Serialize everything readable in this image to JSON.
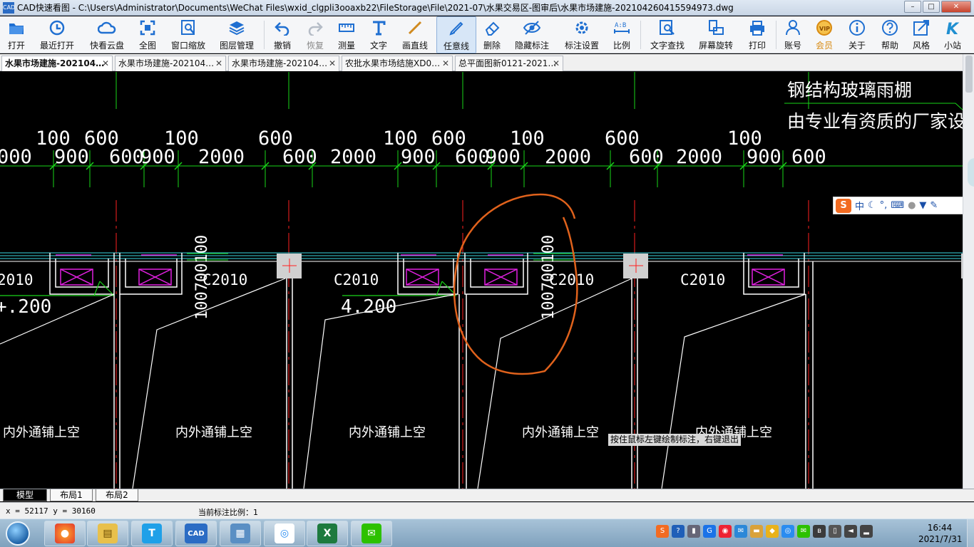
{
  "window": {
    "app_icon": "CAD",
    "title": "CAD快速看图 - C:\\Users\\Administrator\\Documents\\WeChat Files\\wxid_clgpli3ooaxb22\\FileStorage\\File\\2021-07\\水果交易区-图审后\\水果市场建施-202104260415594973.dwg",
    "buttons": {
      "minimize": "–",
      "maximize": "□",
      "close": "✕"
    }
  },
  "toolbar": {
    "items": [
      {
        "label": "打开",
        "icon": "folder-open-icon"
      },
      {
        "label": "最近打开",
        "icon": "recent-clock-icon"
      },
      {
        "label": "快看云盘",
        "icon": "cloud-icon"
      },
      {
        "label": "全图",
        "icon": "fit-extents-icon"
      },
      {
        "label": "窗口缩放",
        "icon": "zoom-window-icon"
      },
      {
        "label": "图层管理",
        "icon": "layers-icon"
      },
      {
        "label": "撤销",
        "icon": "undo-icon"
      },
      {
        "label": "恢复",
        "icon": "redo-icon"
      },
      {
        "label": "测量",
        "icon": "measure-ruler-icon"
      },
      {
        "label": "文字",
        "icon": "text-T-icon"
      },
      {
        "label": "画直线",
        "icon": "line-icon"
      },
      {
        "label": "任意线",
        "icon": "freehand-pen-icon"
      },
      {
        "label": "删除",
        "icon": "eraser-icon"
      },
      {
        "label": "隐藏标注",
        "icon": "eye-hide-icon"
      },
      {
        "label": "标注设置",
        "icon": "annotation-settings-icon"
      },
      {
        "label": "比例",
        "icon": "scale-ab-icon"
      },
      {
        "label": "文字查找",
        "icon": "text-search-icon"
      },
      {
        "label": "屏幕旋转",
        "icon": "rotate-screen-icon"
      },
      {
        "label": "打印",
        "icon": "printer-icon"
      },
      {
        "label": "账号",
        "icon": "user-icon"
      },
      {
        "label": "会员",
        "icon": "vip-badge-icon"
      },
      {
        "label": "关于",
        "icon": "info-icon"
      },
      {
        "label": "帮助",
        "icon": "help-icon"
      },
      {
        "label": "风格",
        "icon": "style-icon"
      },
      {
        "label": "小站",
        "icon": "k-site-icon"
      }
    ],
    "active": "任意线",
    "colors": {
      "icon_blue": "#1f6fd1",
      "vip_gold": "#d88a12"
    }
  },
  "tabs": [
    {
      "label": "水果市场建施-202104…",
      "close": "✕",
      "active": true
    },
    {
      "label": "水果市场建施-202104…",
      "close": "✕",
      "active": false
    },
    {
      "label": "水果市场建施-202104…",
      "close": "✕",
      "active": false
    },
    {
      "label": "农批水果市场结施XD0…",
      "close": "✕",
      "active": false
    },
    {
      "label": "总平面图新0121-2021…",
      "close": "✕",
      "active": false
    }
  ],
  "drawing": {
    "note_line1": "钢结构玻璃雨棚",
    "note_line2": "由专业有资质的厂家设计施工",
    "dims_top": [
      "100",
      "600",
      "100",
      "600",
      "100",
      "600",
      "100",
      "600",
      "100"
    ],
    "dims_bottom": [
      "000",
      "900",
      "600",
      "900",
      "2000",
      "600",
      "2000",
      "900",
      "600",
      "900",
      "2000",
      "600",
      "2000",
      "900",
      "600"
    ],
    "window_tags": [
      "2010",
      "C2010",
      "C2010",
      "C2010",
      "C2010"
    ],
    "elevations": [
      "+.200",
      "4.200"
    ],
    "vertical_dims": [
      "100700100",
      "100700100"
    ],
    "area_labels": [
      "内外通铺上空",
      "内外通铺上空",
      "内外通铺上空",
      "内外通铺上空",
      "内外通铺上空"
    ],
    "colors": {
      "background": "#000000",
      "axis_red": "#ff2020",
      "dim_green": "#19d619",
      "wall_white": "#ffffff",
      "magenta": "#e020e0",
      "cyan": "#39d6e0",
      "markup_orange": "#e0621c"
    }
  },
  "ime_toolbar": {
    "logo": "S",
    "mode": "中",
    "icons": [
      "moon-icon",
      "punctuation-icon",
      "keyboard-icon",
      "user-icon",
      "shirt-icon",
      "wrench-icon"
    ]
  },
  "tooltip": "按住鼠标左键绘制标注，右键退出",
  "layout_tabs": [
    "模型",
    "布局1",
    "布局2"
  ],
  "status": {
    "coords": "x = 52117  y = 30160",
    "scale": "当前标注比例：1"
  },
  "taskbar": {
    "apps": [
      {
        "name": "firefox-icon",
        "glyph": "●"
      },
      {
        "name": "file-explorer-icon",
        "glyph": "▤"
      },
      {
        "name": "t-app-icon",
        "glyph": "T"
      },
      {
        "name": "cad-viewer-icon",
        "glyph": "CAD"
      },
      {
        "name": "remote-desktop-icon",
        "glyph": "▦"
      },
      {
        "name": "baidu-netdisk-icon",
        "glyph": "◎"
      },
      {
        "name": "excel-icon",
        "glyph": "X"
      },
      {
        "name": "wechat-icon",
        "glyph": "✉"
      }
    ],
    "time": "16:44",
    "date": "2021/7/31"
  }
}
